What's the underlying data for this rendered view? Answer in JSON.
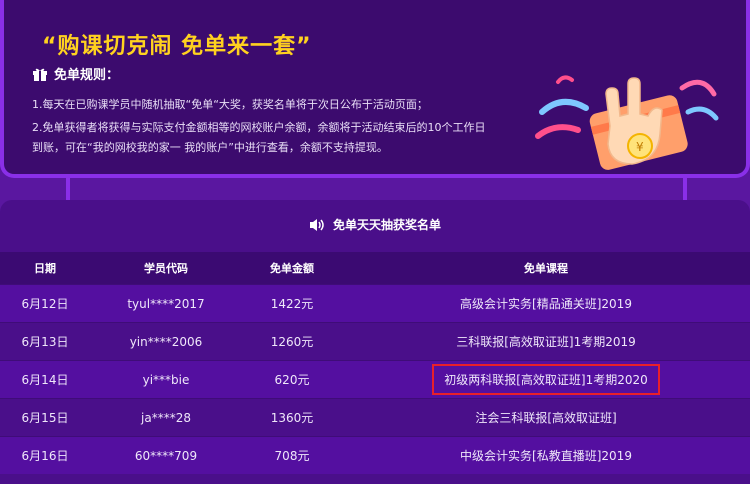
{
  "promo": {
    "slogan": "“购课切克闹 免单来一套”",
    "rules_title": "免单规则：",
    "rules": [
      "1.每天在已购课学员中随机抽取“免单“大奖，获奖名单将于次日公布于活动页面；",
      "2.免单获得者将获得与实际支付金额相等的网校账户余额，余额将于活动结束后的10个工作日",
      "到账，可在“我的网校我的家一 我的账户”中进行查看，余额不支持提现。"
    ]
  },
  "winners": {
    "title": "免单天天抽获奖名单",
    "columns": [
      "日期",
      "学员代码",
      "免单金额",
      "免单课程"
    ],
    "rows": [
      {
        "date": "6月12日",
        "code": "tyul****2017",
        "amount": "1422元",
        "course": "高级会计实务[精品通关班]2019",
        "highlighted": false
      },
      {
        "date": "6月13日",
        "code": "yin****2006",
        "amount": "1260元",
        "course": "三科联报[高效取证班]1考期2019",
        "highlighted": false
      },
      {
        "date": "6月14日",
        "code": "yi***bie",
        "amount": "620元",
        "course": "初级两科联报[高效取证班]1考期2020",
        "highlighted": true
      },
      {
        "date": "6月15日",
        "code": "ja****28",
        "amount": "1360元",
        "course": "注会三科联报[高效取证班]",
        "highlighted": false
      },
      {
        "date": "6月16日",
        "code": "60****709",
        "amount": "708元",
        "course": "中级会计实务[私教直播班]2019",
        "highlighted": false
      }
    ]
  },
  "colors": {
    "slogan": "#ffd21f",
    "highlight_border": "#e8202a",
    "page_bg": "#5a17a0"
  },
  "icons": [
    "gift-icon",
    "speaker-icon",
    "hand-coin-illustration"
  ]
}
